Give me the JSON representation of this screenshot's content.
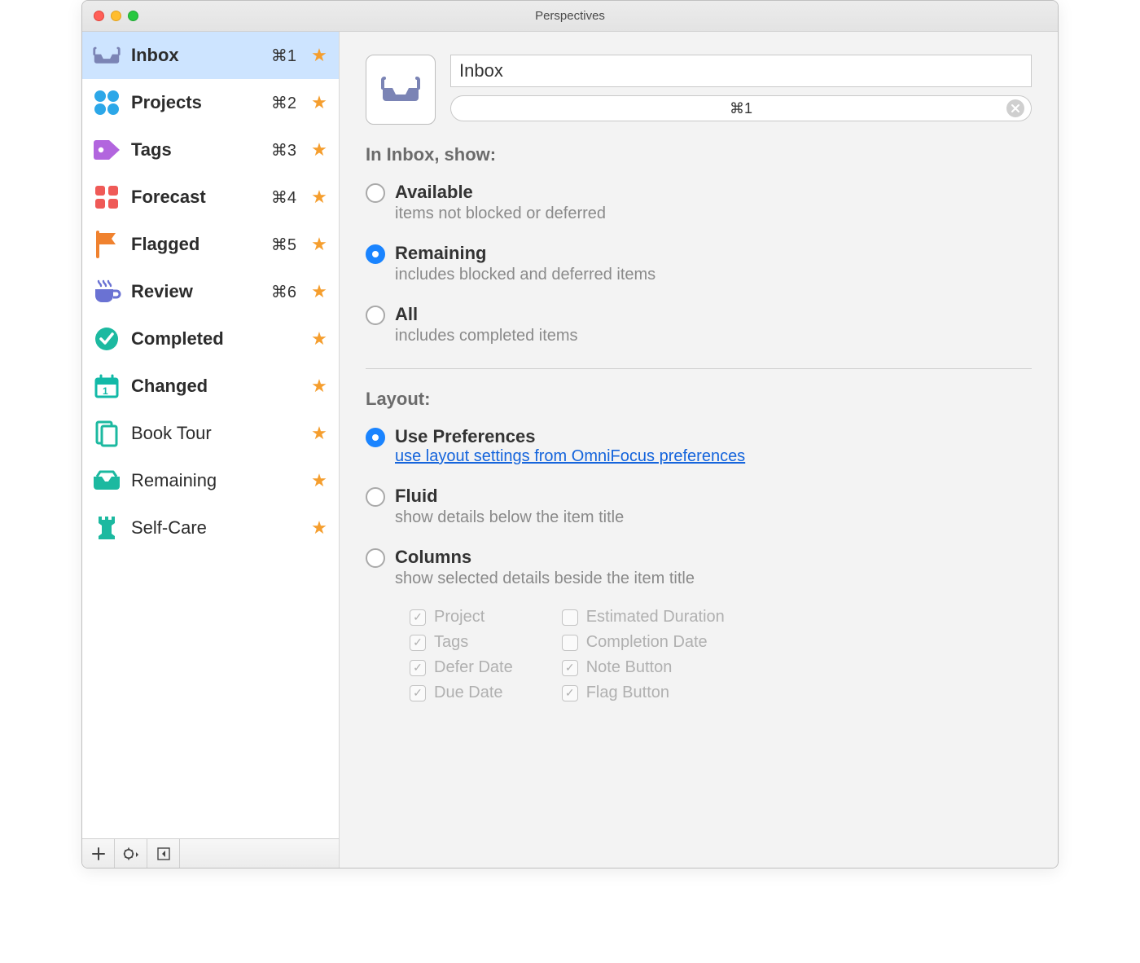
{
  "window_title": "Perspectives",
  "sidebar": {
    "items": [
      {
        "id": "inbox",
        "label": "Inbox",
        "shortcut": "⌘1",
        "starred": true,
        "bold": true,
        "selected": true,
        "icon": {
          "name": "inbox-tray-icon",
          "color": "#7b84b5"
        }
      },
      {
        "id": "projects",
        "label": "Projects",
        "shortcut": "⌘2",
        "starred": true,
        "bold": true,
        "icon": {
          "name": "dots-icon",
          "color": "#2ca7e8"
        }
      },
      {
        "id": "tags",
        "label": "Tags",
        "shortcut": "⌘3",
        "starred": true,
        "bold": true,
        "icon": {
          "name": "tag-icon",
          "color": "#b265de"
        }
      },
      {
        "id": "forecast",
        "label": "Forecast",
        "shortcut": "⌘4",
        "starred": true,
        "bold": true,
        "icon": {
          "name": "grid4-icon",
          "color": "#ef5a57"
        }
      },
      {
        "id": "flagged",
        "label": "Flagged",
        "shortcut": "⌘5",
        "starred": true,
        "bold": true,
        "icon": {
          "name": "flag-icon",
          "color": "#f0822f"
        }
      },
      {
        "id": "review",
        "label": "Review",
        "shortcut": "⌘6",
        "starred": true,
        "bold": true,
        "icon": {
          "name": "cup-icon",
          "color": "#6a72d3"
        }
      },
      {
        "id": "completed",
        "label": "Completed",
        "shortcut": "",
        "starred": true,
        "bold": true,
        "icon": {
          "name": "check-circle-icon",
          "color": "#1cb9a0"
        }
      },
      {
        "id": "changed",
        "label": "Changed",
        "shortcut": "",
        "starred": true,
        "bold": true,
        "icon": {
          "name": "calendar-icon",
          "color": "#12b9a7"
        }
      },
      {
        "id": "booktour",
        "label": "Book Tour",
        "shortcut": "",
        "starred": true,
        "bold": false,
        "icon": {
          "name": "stack-icon",
          "color": "#1cb9a0"
        }
      },
      {
        "id": "remaining",
        "label": "Remaining",
        "shortcut": "",
        "starred": true,
        "bold": false,
        "icon": {
          "name": "open-tray-icon",
          "color": "#1cb9a0"
        }
      },
      {
        "id": "selfcare",
        "label": "Self-Care",
        "shortcut": "",
        "starred": true,
        "bold": false,
        "icon": {
          "name": "rook-icon",
          "color": "#1cb9a0"
        }
      }
    ]
  },
  "detail": {
    "name_value": "Inbox",
    "shortcut_value": "⌘1",
    "show_section_title": "In Inbox, show:",
    "show_options": [
      {
        "id": "available",
        "title": "Available",
        "sub": "items not blocked or deferred",
        "selected": false
      },
      {
        "id": "remaining",
        "title": "Remaining",
        "sub": "includes blocked and deferred items",
        "selected": true
      },
      {
        "id": "all",
        "title": "All",
        "sub": "includes completed items",
        "selected": false
      }
    ],
    "layout_section_title": "Layout:",
    "layout_options": [
      {
        "id": "use-prefs",
        "title": "Use Preferences",
        "link": "use layout settings from OmniFocus preferences",
        "selected": true
      },
      {
        "id": "fluid",
        "title": "Fluid",
        "sub": "show details below the item title",
        "selected": false
      },
      {
        "id": "columns",
        "title": "Columns",
        "sub": "show selected details beside the item title",
        "selected": false
      }
    ],
    "column_checks_left": [
      {
        "label": "Project",
        "checked": true
      },
      {
        "label": "Tags",
        "checked": true
      },
      {
        "label": "Defer Date",
        "checked": true
      },
      {
        "label": "Due Date",
        "checked": true
      }
    ],
    "column_checks_right": [
      {
        "label": "Estimated Duration",
        "checked": false
      },
      {
        "label": "Completion Date",
        "checked": false
      },
      {
        "label": "Note Button",
        "checked": true
      },
      {
        "label": "Flag Button",
        "checked": true
      }
    ]
  }
}
